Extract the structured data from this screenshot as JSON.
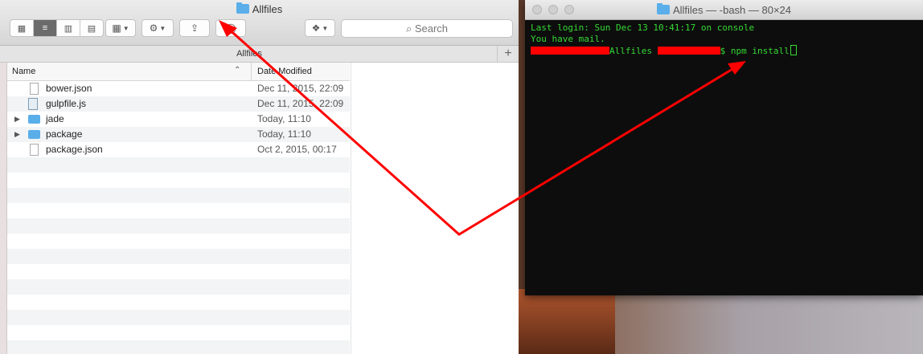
{
  "finder": {
    "title": "Allfiles",
    "search_placeholder": "Search",
    "path_label": "Allfiles",
    "plus_label": "+",
    "columns": {
      "name": "Name",
      "date": "Date Modified",
      "sort_caret": "^"
    },
    "files": [
      {
        "name": "bower.json",
        "date": "Dec 11, 2015, 22:09",
        "kind": "doc"
      },
      {
        "name": "gulpfile.js",
        "date": "Dec 11, 2015, 22:09",
        "kind": "js"
      },
      {
        "name": "jade",
        "date": "Today, 11:10",
        "kind": "folder"
      },
      {
        "name": "package",
        "date": "Today, 11:10",
        "kind": "folder"
      },
      {
        "name": "package.json",
        "date": "Oct 2, 2015, 00:17",
        "kind": "doc"
      }
    ]
  },
  "terminal": {
    "title": "Allfiles — -bash — 80×24",
    "line1": "Last login: Sun Dec 13 10:41:17 on console",
    "line2": "You have mail.",
    "prompt_dir": "Allfiles",
    "prompt_cmd": "$ npm install"
  },
  "colors": {
    "arrow": "#ff0000",
    "terminal_text": "#35d935",
    "folder": "#5aaeea"
  }
}
